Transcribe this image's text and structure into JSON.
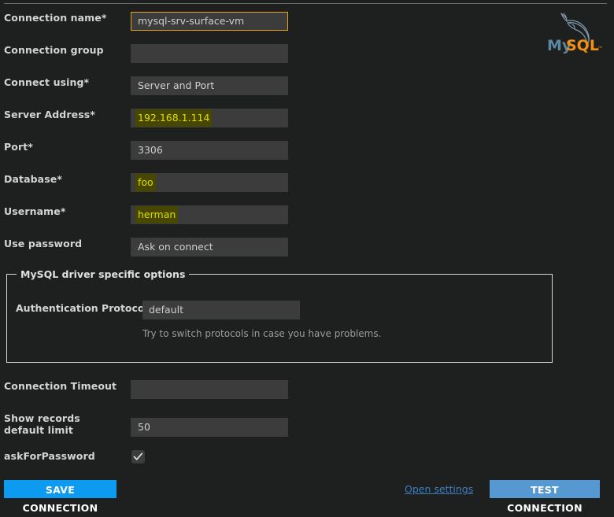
{
  "brand": {
    "logo_my": "My",
    "logo_sql": "SQL",
    "logo_tm": "™",
    "color_my": "#5d87a1",
    "color_sql": "#f29111",
    "color_dolphin": "#7e9bb0"
  },
  "colors": {
    "background": "#1e1f1f",
    "field_bg": "#3c3c3c",
    "focus_border": "#e8a317",
    "highlight_bg": "#474700",
    "highlight_text": "#dede00",
    "save_button": "#0d9bf2",
    "test_button": "#5699d2",
    "link": "#3d7fc1",
    "fieldset_border": "#d8d8d2"
  },
  "form": {
    "rows": [
      {
        "label": "Connection name*",
        "value": "mysql-srv-surface-vm",
        "placeholder": "",
        "focused": true,
        "highlighted": false,
        "name": "connection-name"
      },
      {
        "label": "Connection group",
        "value": "",
        "placeholder": "",
        "focused": false,
        "highlighted": false,
        "name": "connection-group"
      },
      {
        "label": "Connect using*",
        "value": "Server and Port",
        "placeholder": "",
        "focused": false,
        "highlighted": false,
        "name": "connect-using"
      },
      {
        "label": "Server Address*",
        "value": "192.168.1.114",
        "placeholder": "",
        "focused": false,
        "highlighted": true,
        "name": "server-address"
      },
      {
        "label": "Port*",
        "value": "3306",
        "placeholder": "",
        "focused": false,
        "highlighted": false,
        "name": "port"
      },
      {
        "label": "Database*",
        "value": "foo",
        "placeholder": "",
        "focused": false,
        "highlighted": true,
        "name": "database"
      },
      {
        "label": "Username*",
        "value": "herman",
        "placeholder": "",
        "focused": false,
        "highlighted": true,
        "name": "username"
      },
      {
        "label": "Use password",
        "value": "Ask on connect",
        "placeholder": "",
        "focused": false,
        "highlighted": false,
        "name": "use-password"
      }
    ],
    "bottom_rows": [
      {
        "label": "Connection Timeout",
        "value": "",
        "placeholder": "",
        "focused": false,
        "highlighted": false,
        "name": "connection-timeout"
      },
      {
        "label": "Show records default limit",
        "value": "50",
        "placeholder": "",
        "focused": false,
        "highlighted": false,
        "name": "show-records-default-limit"
      }
    ]
  },
  "driver_options": {
    "legend": "MySQL driver specific options",
    "auth_protocol_label": "Authentication Protocol",
    "auth_protocol_value": "default",
    "hint": "Try to switch protocols in case you have problems."
  },
  "ask_for_password": {
    "label": "askForPassword",
    "checked": true
  },
  "actions": {
    "save_label": "SAVE CONNECTION",
    "open_settings_label": "Open settings",
    "test_label": "TEST CONNECTION"
  }
}
